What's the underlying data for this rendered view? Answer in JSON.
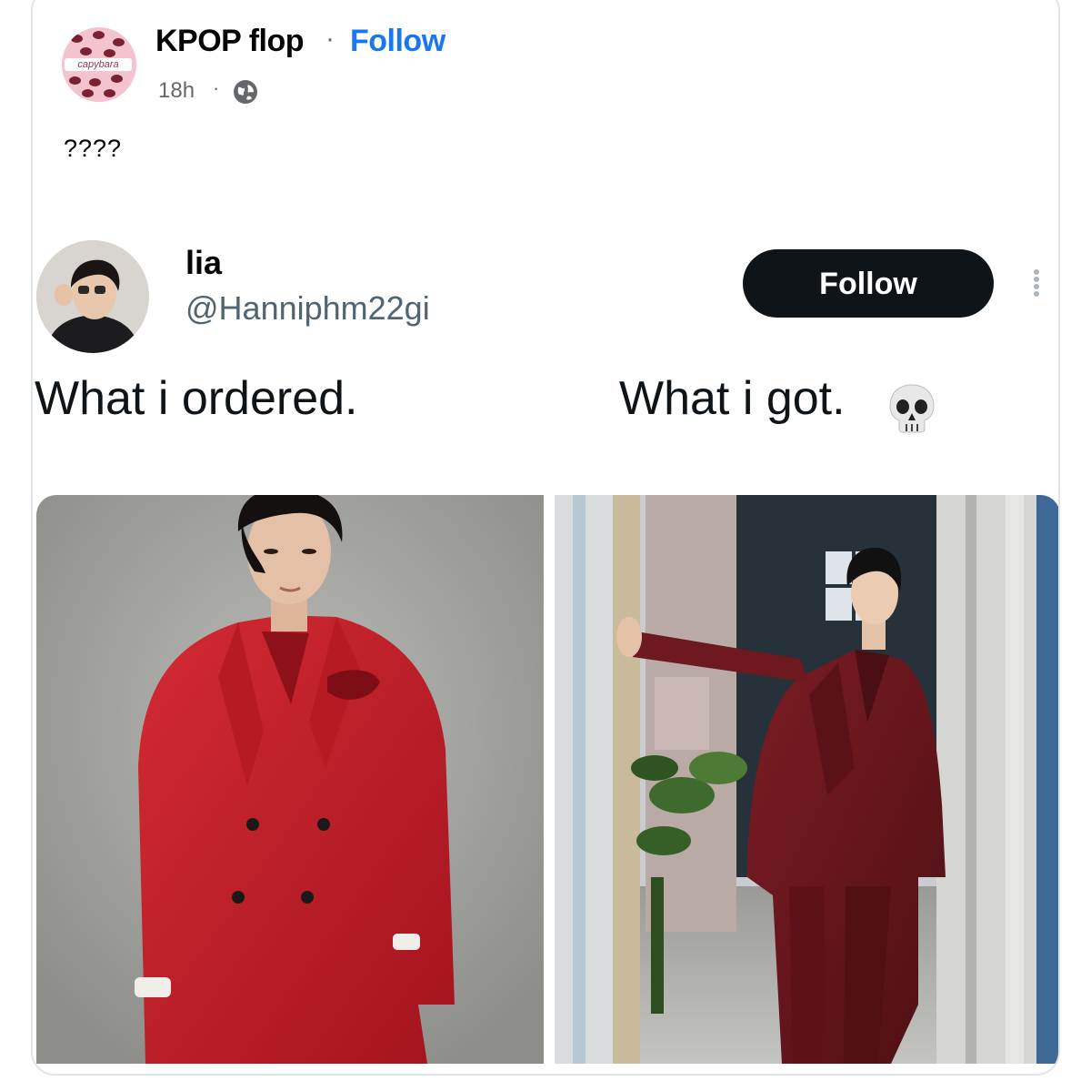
{
  "post": {
    "page_name": "KPOP flop",
    "separator": "·",
    "follow_label": "Follow",
    "time": "18h",
    "time_separator": "·",
    "audience_icon": "globe-icon",
    "caption": "????",
    "avatar_text": "capybara"
  },
  "tweet": {
    "display_name": "lia",
    "handle": "@Hanniphm22gi",
    "follow_label": "Follow",
    "more_icon": "vertical-ellipsis-icon",
    "text_left": "What i ordered.",
    "text_right": "What i got.",
    "emoji_icon": "skull-icon"
  },
  "colors": {
    "facebook_blue": "#1877f2",
    "twitter_follow_bg": "#0f1419",
    "muted_text": "#65676b",
    "handle_text": "#536471",
    "suit_red": "#c8202c",
    "suit_burgundy": "#6e1820"
  }
}
